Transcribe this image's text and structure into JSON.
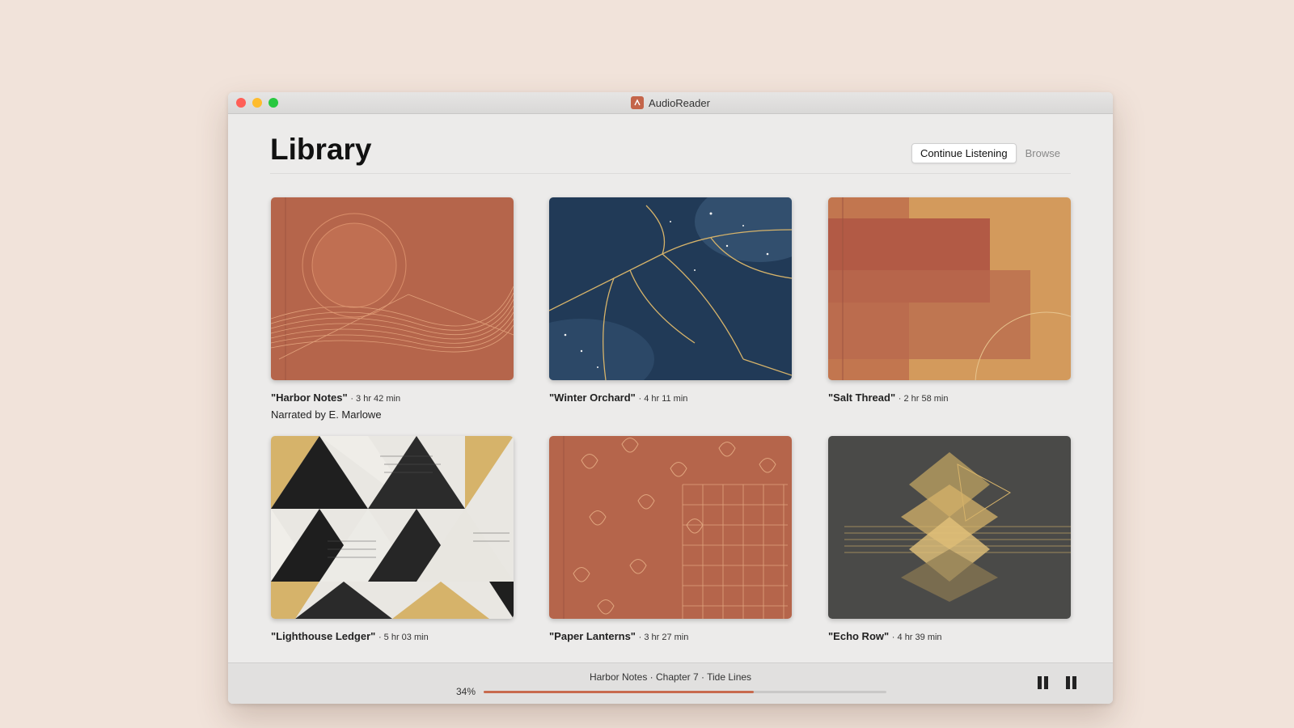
{
  "window": {
    "title": "AudioReader"
  },
  "header": {
    "title": "Library",
    "tabs": [
      "Continue Listening",
      "Browse"
    ],
    "active_tab": "Continue Listening"
  },
  "books": [
    {
      "title": "\"Harbor Notes\"",
      "duration": "· 3 hr 42 min",
      "narrator": "Narrated by E. Marlowe"
    },
    {
      "title": "\"Winter Orchard\"",
      "duration": "· 4 hr 11 min"
    },
    {
      "title": "\"Salt Thread\"",
      "duration": "· 2 hr 58 min"
    },
    {
      "title": "\"Lighthouse Ledger\"",
      "duration": "· 5 hr 03 min"
    },
    {
      "title": "\"Paper Lanterns\"",
      "duration": "· 3 hr 27 min"
    },
    {
      "title": "\"Echo Row\"",
      "duration": "· 4 hr 39 min"
    }
  ],
  "player": {
    "now_playing": "Harbor Notes · Chapter 7 · Tide Lines",
    "progress_label": "34%",
    "progress": 0.67
  },
  "colors": {
    "accent": "#c86a4e",
    "terracotta": "#b5654b",
    "navy": "#213a57",
    "ochre": "#d39a5c",
    "charcoal": "#4a4a48",
    "gold": "#d6b36a"
  }
}
